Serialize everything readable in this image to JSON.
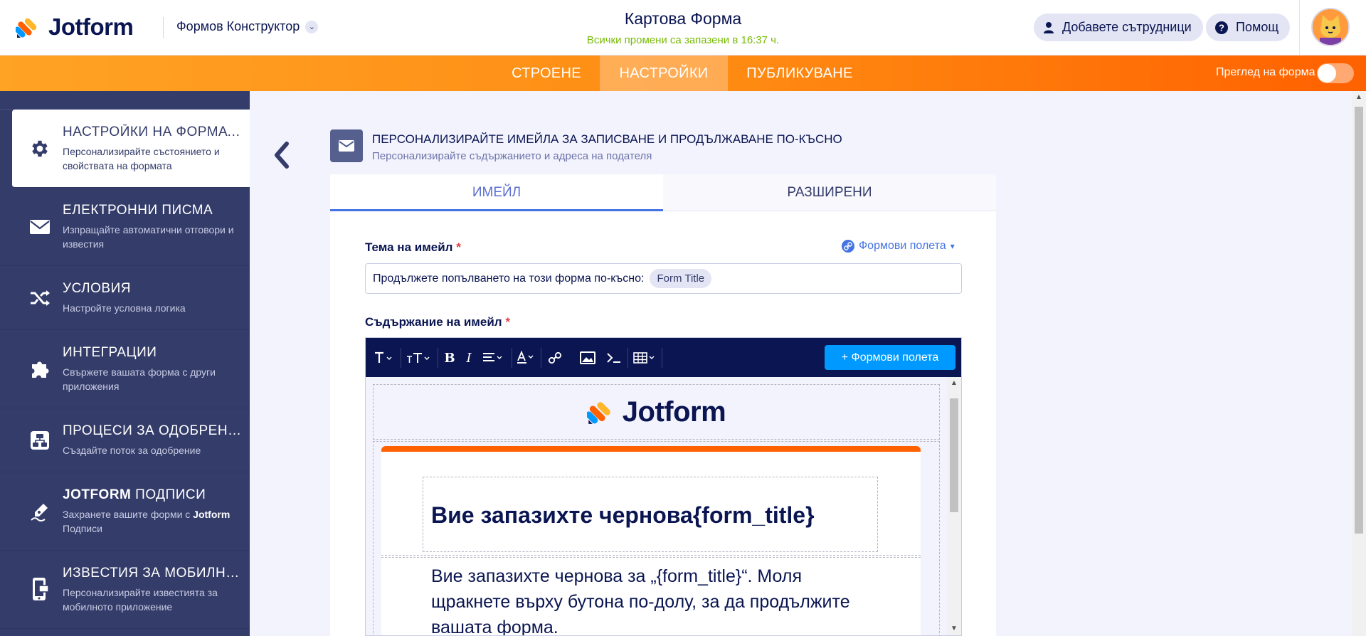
{
  "header": {
    "logo_text": "Jotform",
    "builder_label": "Формов Конструктор",
    "form_title": "Картова Форма",
    "save_status": "Всички промени са запазени в 16:37 ч.",
    "add_collaborators": "Добавете сътрудници",
    "help": "Помощ"
  },
  "nav": {
    "tabs": [
      "СТРОЕНЕ",
      "НАСТРОЙКИ",
      "ПУБЛИКУВАНЕ"
    ],
    "active_tab": "НАСТРОЙКИ",
    "preview_label": "Преглед на форма",
    "preview_enabled": false
  },
  "sidebar": {
    "items": [
      {
        "title": "НАСТРОЙКИ НА ФОРМАТА",
        "desc": "Персонализирайте състоянието и свойствата на формата",
        "icon": "gear-icon",
        "active": true
      },
      {
        "title": "ЕЛЕКТРОННИ ПИСМА",
        "desc": "Изпращайте автоматични отговори и известия",
        "icon": "envelope-icon"
      },
      {
        "title": "УСЛОВИЯ",
        "desc": "Настройте условна логика",
        "icon": "shuffle-icon"
      },
      {
        "title": "ИНТЕГРАЦИИ",
        "desc": "Свържете вашата форма с други приложения",
        "icon": "puzzle-icon"
      },
      {
        "title": "ПРОЦЕСИ ЗА ОДОБРЕНИЕ",
        "desc": "Създайте поток за одобрение",
        "icon": "flow-icon"
      },
      {
        "title_prefix": "JOTFORM",
        "title_suffix": " ПОДПИСИ",
        "desc_prefix": "Захранете вашите форми с ",
        "desc_bold": "Jotform",
        "desc_suffix": " Подписи",
        "icon": "pen-icon"
      },
      {
        "title": "ИЗВЕСТИЯ ЗА МОБИЛНИ ...",
        "desc": "Персонализирайте известията за мобилното приложение",
        "icon": "mobile-icon"
      }
    ]
  },
  "panel": {
    "title": "ПЕРСОНАЛИЗИРАЙТЕ ИМЕЙЛА ЗА ЗАПИСВАНЕ И ПРОДЪЛЖАВАНЕ ПО-КЪСНО",
    "subtitle": "Персонализирайте съдържанието и адреса на подателя",
    "tabs": [
      "ИМЕЙЛ",
      "РАЗШИРЕНИ"
    ],
    "active_tab": "ИМЕЙЛ"
  },
  "form": {
    "subject_label": "Тема на имейл",
    "required_mark": "*",
    "form_fields_link": "Формови полета",
    "subject_text": "Продължете попълването на този форма по-късно:",
    "subject_tag": "Form Title",
    "content_label": "Съдържание на имейл",
    "toolbar_fields_button": "+ Формови полета"
  },
  "email_preview": {
    "logo_text": "Jotform",
    "heading": "Вие запазихте чернова{form_title}",
    "paragraph": "Вие запазихте чернова за „{form_title}“. Моля щракнете върху бутона по-долу, за да продължите вашата форма.",
    "accent_color": "#ff6100"
  },
  "colors": {
    "brand_navy": "#0a1551",
    "sidebar_bg": "#343c6a",
    "nav_orange": "#ff8a12",
    "save_green": "#78bb07",
    "link_blue": "#4573e3",
    "button_blue": "#0099ff"
  }
}
